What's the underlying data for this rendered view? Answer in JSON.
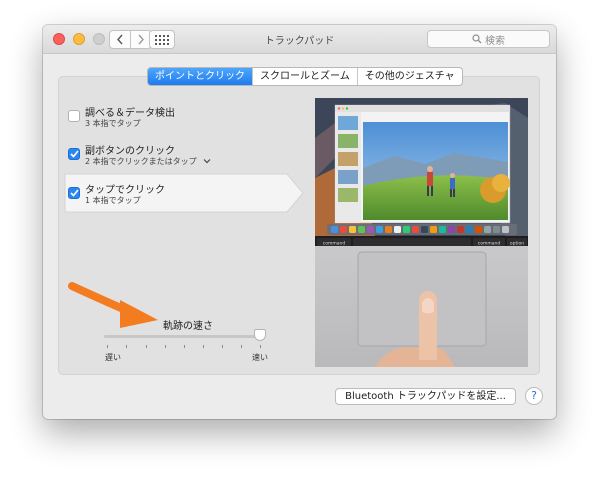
{
  "window": {
    "title": "トラックパッド",
    "search_placeholder": "検索"
  },
  "tabs": [
    {
      "label": "ポイントとクリック",
      "active": true
    },
    {
      "label": "スクロールとズーム",
      "active": false
    },
    {
      "label": "その他のジェスチャ",
      "active": false
    }
  ],
  "options": [
    {
      "label": "調べる＆データ検出",
      "sub": "3 本指でタップ",
      "checked": false
    },
    {
      "label": "副ボタンのクリック",
      "sub": "2 本指でクリックまたはタップ",
      "checked": true
    },
    {
      "label": "タップでクリック",
      "sub": "1 本指でタップ",
      "checked": true
    }
  ],
  "tracking": {
    "label": "軌跡の速さ",
    "min_label": "遅い",
    "max_label": "速い",
    "value_fraction": 0.98
  },
  "preview": {
    "keys": [
      "command",
      "command",
      "option"
    ]
  },
  "footer": {
    "bluetooth_button": "Bluetooth トラックパッドを設定...",
    "help": "?"
  },
  "colors": {
    "accent": "#1f7bef",
    "annotation_arrow": "#f47c20"
  }
}
